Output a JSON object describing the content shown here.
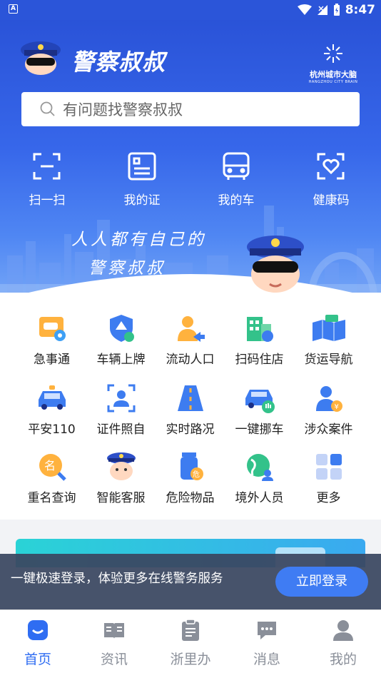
{
  "status_bar": {
    "time": "8:47",
    "indicator": "A"
  },
  "header": {
    "app_title": "警察叔叔",
    "partner_name_zh": "杭州城市大脑",
    "partner_name_en": "HANGZHOU CITY BRAIN"
  },
  "search": {
    "placeholder": "有问题找警察叔叔",
    "icon": "search-icon"
  },
  "quick_actions": [
    {
      "label": "扫一扫",
      "icon": "scan-icon"
    },
    {
      "label": "我的证",
      "icon": "id-card-icon"
    },
    {
      "label": "我的车",
      "icon": "car-front-icon"
    },
    {
      "label": "健康码",
      "icon": "health-code-icon"
    }
  ],
  "hero": {
    "slogan_line1": "人人都有自己的",
    "slogan_line2": "警察叔叔"
  },
  "services": [
    {
      "label": "急事通",
      "icon": "urgent-car-icon"
    },
    {
      "label": "车辆上牌",
      "icon": "vehicle-plate-icon"
    },
    {
      "label": "流动人口",
      "icon": "floating-population-icon"
    },
    {
      "label": "扫码住店",
      "icon": "hotel-checkin-icon"
    },
    {
      "label": "货运导航",
      "icon": "freight-map-icon"
    },
    {
      "label": "平安110",
      "icon": "police-car-icon"
    },
    {
      "label": "证件照自",
      "icon": "id-photo-icon"
    },
    {
      "label": "实时路况",
      "icon": "road-condition-icon"
    },
    {
      "label": "一键挪车",
      "icon": "move-car-icon"
    },
    {
      "label": "涉众案件",
      "icon": "mass-case-icon"
    },
    {
      "label": "重名查询",
      "icon": "name-search-icon"
    },
    {
      "label": "智能客服",
      "icon": "smart-service-icon"
    },
    {
      "label": "危险物品",
      "icon": "hazardous-goods-icon"
    },
    {
      "label": "境外人员",
      "icon": "foreigner-icon"
    },
    {
      "label": "更多",
      "icon": "more-grid-icon"
    }
  ],
  "login_prompt": {
    "text": "一键极速登录，体验更多在线警务服务",
    "button": "立即登录"
  },
  "tabs": [
    {
      "label": "首页",
      "icon": "home-icon",
      "active": true
    },
    {
      "label": "资讯",
      "icon": "news-icon",
      "active": false
    },
    {
      "label": "浙里办",
      "icon": "clipboard-icon",
      "active": false
    },
    {
      "label": "消息",
      "icon": "message-icon",
      "active": false
    },
    {
      "label": "我的",
      "icon": "profile-icon",
      "active": false
    }
  ],
  "colors": {
    "brand_blue": "#2b55d9",
    "accent_blue": "#3f7cf3",
    "active_tab": "#2f6df2",
    "inactive_tab": "#8a8f99"
  }
}
